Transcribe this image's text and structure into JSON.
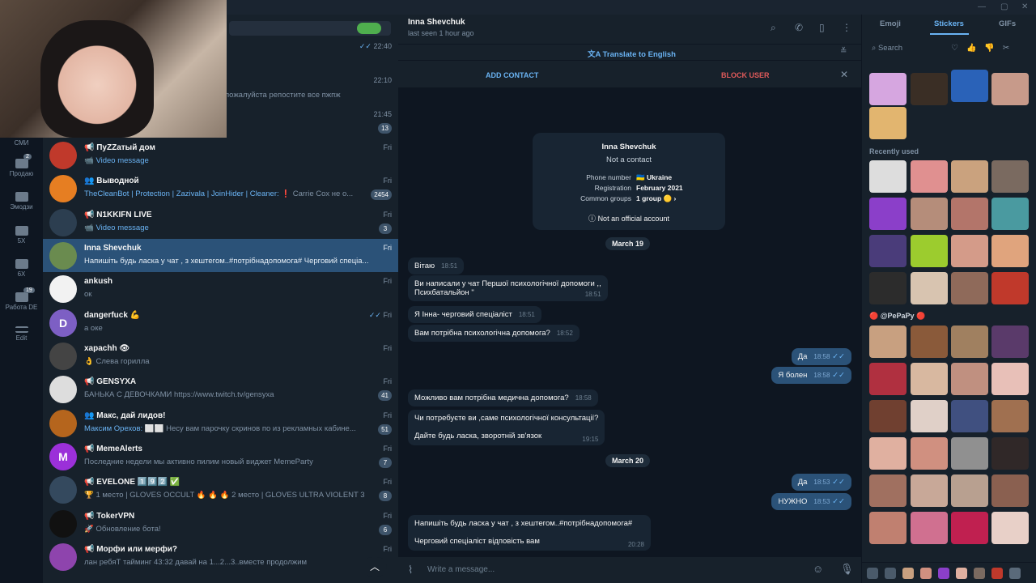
{
  "folders": [
    {
      "label": "СМИ",
      "badge": ""
    },
    {
      "label": "Продаю",
      "badge": "2"
    },
    {
      "label": "Эмодзи",
      "badge": ""
    },
    {
      "label": "5X",
      "badge": ""
    },
    {
      "label": "6X",
      "badge": ""
    },
    {
      "label": "Работа DE",
      "badge": "19"
    },
    {
      "label": "Edit",
      "badge": ""
    }
  ],
  "partial_chats": [
    {
      "time": "22:40",
      "preview": ""
    },
    {
      "time": "22:10",
      "preview": "пожалуйста репостите все пжпж"
    },
    {
      "time": "21:45",
      "badge": "13"
    }
  ],
  "chats": [
    {
      "name": "📢 ПуZZатый дом",
      "prefix": "",
      "preview": "Video message",
      "time": "Fri",
      "badge": "",
      "color": "#c0392b"
    },
    {
      "name": "👥 Выводной",
      "prefix": "TheCleanBot | Protection | Zazivala | JoinHider | Cleaner:",
      "preview": " ❗ Carrie Cox не о...",
      "time": "Fri",
      "badge": "2454",
      "color": "#e67e22"
    },
    {
      "name": "📢 N1KKIFN LIVE",
      "prefix": "",
      "preview": "Video message",
      "time": "Fri",
      "badge": "3",
      "color": "#2c3e50"
    },
    {
      "name": "Inna Shevchuk",
      "prefix": "",
      "preview": "Напишіть будь ласка у чат , з хештегом..#потрібнадопомога#  Черговий спеціа...",
      "time": "Fri",
      "badge": "",
      "color": "#6a8b4f"
    },
    {
      "name": "ankush",
      "prefix": "",
      "preview": "ок",
      "time": "Fri",
      "badge": "",
      "color": "#f2f2f2"
    },
    {
      "name": "dangerfuck 💪",
      "prefix": "",
      "preview": "а оке",
      "time": "Fri",
      "badge": "",
      "color": "#7d5fc4",
      "letter": "D",
      "read": true
    },
    {
      "name": "xapachh 👁",
      "prefix": "",
      "preview": "👌 Слева горилла",
      "time": "Fri",
      "badge": "",
      "color": "#444"
    },
    {
      "name": "📢 GENSYXA",
      "prefix": "",
      "preview": "БАНЬКА С ДЕВОЧКАМИ https://www.twitch.tv/gensyxa",
      "time": "Fri",
      "badge": "41",
      "color": "#ddd"
    },
    {
      "name": "👥 Макс, дай лидов!",
      "prefix": "Максим Орехов:",
      "preview": " ⬜⬜ Несу вам парочку скринов по из рекламных кабине...",
      "time": "Fri",
      "badge": "51",
      "color": "#b5651d"
    },
    {
      "name": "📢 MemeAlerts",
      "prefix": "",
      "preview": "Последние недели мы активно пилим новый виджет MemeParty",
      "time": "Fri",
      "badge": "7",
      "color": "#9b30d9",
      "letter": "M"
    },
    {
      "name": "📢 EVELONE 1️⃣9️⃣2️⃣ ✅",
      "prefix": "",
      "preview": "🏆 1 место | GLOVES OCCULT 🔥 🔥 🔥 2 место | GLOVES ULTRA VIOLENT 3 ...",
      "time": "Fri",
      "badge": "8",
      "color": "#34495e"
    },
    {
      "name": "📢 TokerVPN",
      "prefix": "",
      "preview": "🚀 Обновление бота!",
      "time": "Fri",
      "badge": "6",
      "color": "#111"
    },
    {
      "name": "📢 Морфи или мерфи?",
      "prefix": "",
      "preview": "лан ребяТ тайминг 43:32 давай на 1...2...3..вместе продолжим",
      "time": "Fri",
      "badge": "",
      "color": "#8e44ad"
    }
  ],
  "header": {
    "name": "Inna Shevchuk",
    "status": "last seen 1 hour ago"
  },
  "translate_label": "Translate to English",
  "add_contact_label": "ADD CONTACT",
  "block_user_label": "BLOCK USER",
  "card": {
    "name": "Inna Shevchuk",
    "sub": "Not a contact",
    "phone_label": "Phone number",
    "phone_value": "🇺🇦 Ukraine",
    "reg_label": "Registration",
    "reg_value": "February 2021",
    "groups_label": "Common groups",
    "groups_value": "1 group 🟡 ›",
    "official": "Not an official account"
  },
  "dates": {
    "d1": "March 19",
    "d2": "March 20"
  },
  "messages": {
    "m1": {
      "text": "Вітаю",
      "time": "18:51"
    },
    "m2": {
      "line1": "Ви написали у чат Першої психологічної допомоги ,,",
      "line2": "Психбатальйон \"",
      "time": "18:51"
    },
    "m3": {
      "text": "Я Інна- черговий спеціаліст",
      "time": "18:51"
    },
    "m4": {
      "text": "Вам потрібна психологічна допомога?",
      "time": "18:52"
    },
    "m5": {
      "text": "Да",
      "time": "18:58"
    },
    "m6": {
      "text": "Я болен",
      "time": "18:58"
    },
    "m7": {
      "text": "Можливо вам потрібна медична допомога?",
      "time": "18:58"
    },
    "m8": {
      "line1": "Чи потребуєте ви ,саме психологічної  консультації?",
      "line2": "Дайте будь ласка, зворотній зв'язок",
      "time": "19:15"
    },
    "m9": {
      "text": "Да",
      "time": "18:53"
    },
    "m10": {
      "text": "НУЖНО",
      "time": "18:53"
    },
    "m11": {
      "line1": "Напишіть будь ласка у чат , з хештегом..#потрібнадопомога#",
      "line2": "Черговий спеціаліст відповість вам",
      "time": "20:28"
    }
  },
  "composer_placeholder": "Write a message...",
  "stickers": {
    "tab_emoji": "Emoji",
    "tab_stickers": "Stickers",
    "tab_gifs": "GIFs",
    "search_placeholder": "Search",
    "recent_label": "Recently used",
    "pack_label": "🔴 @PePaPy 🔴"
  }
}
